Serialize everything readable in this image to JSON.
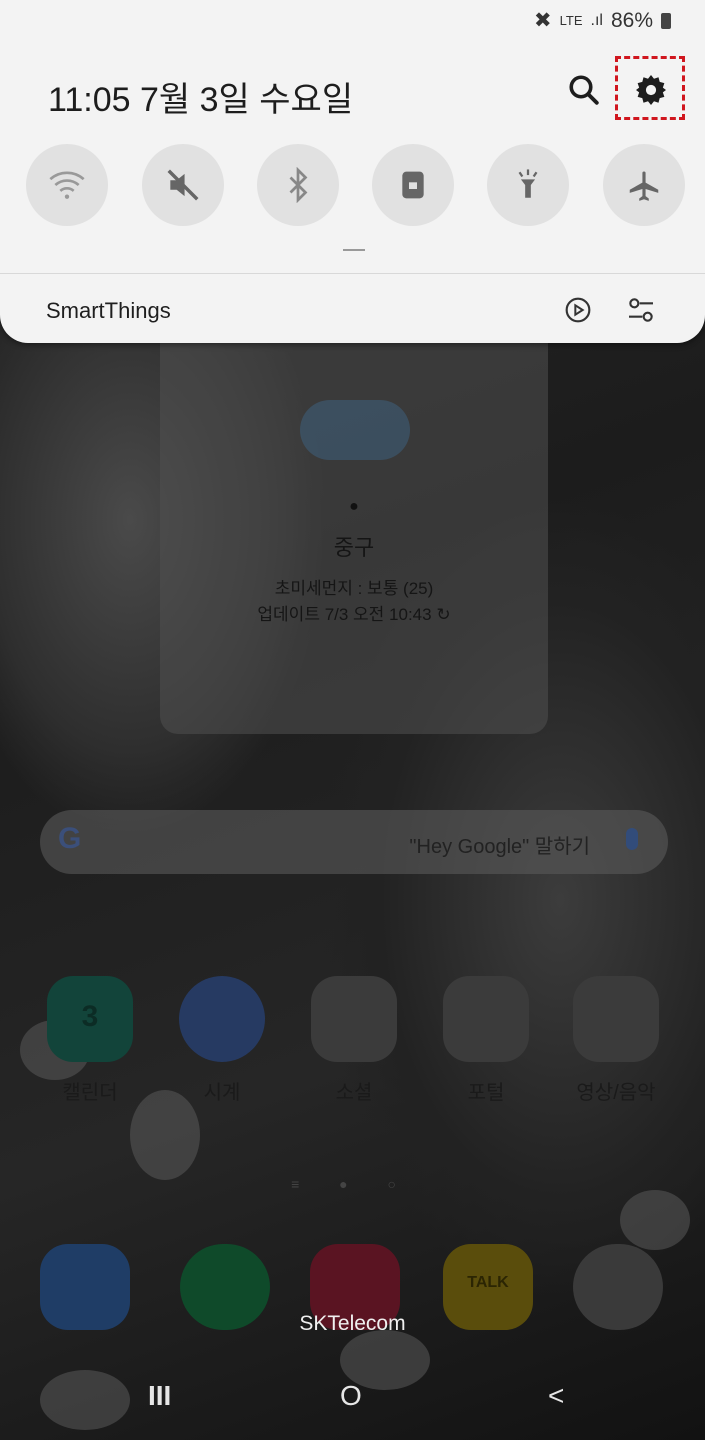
{
  "status_bar": {
    "battery": "86%",
    "network": "LTE"
  },
  "panel": {
    "datetime": "11:05  7월 3일 수요일",
    "quick_toggles": [
      {
        "icon": "wifi-icon"
      },
      {
        "icon": "mute-icon"
      },
      {
        "icon": "bluetooth-icon"
      },
      {
        "icon": "screen-rotation-lock-icon"
      },
      {
        "icon": "flashlight-icon"
      },
      {
        "icon": "airplane-mode-icon"
      }
    ],
    "smartthings_label": "SmartThings"
  },
  "weather": {
    "location": "중구",
    "fine_dust": "초미세먼지 : 보통 (25)",
    "updated": "업데이트 7/3 오전 10:43"
  },
  "google_bar": {
    "g": "G",
    "hint": "\"Hey Google\" 말하기"
  },
  "apps": [
    {
      "label": "캘린더",
      "badge": "3"
    },
    {
      "label": "시계"
    },
    {
      "label": "소셜"
    },
    {
      "label": "포털"
    },
    {
      "label": "영상/음악"
    }
  ],
  "dock": {
    "kakao_label": "TALK",
    "carrier": "SKTelecom"
  },
  "nav": {
    "recents": "III",
    "home": "O",
    "back": "<"
  },
  "colors": {
    "highlight": "#d0161e",
    "panel_bg": "#f3f3f3"
  }
}
